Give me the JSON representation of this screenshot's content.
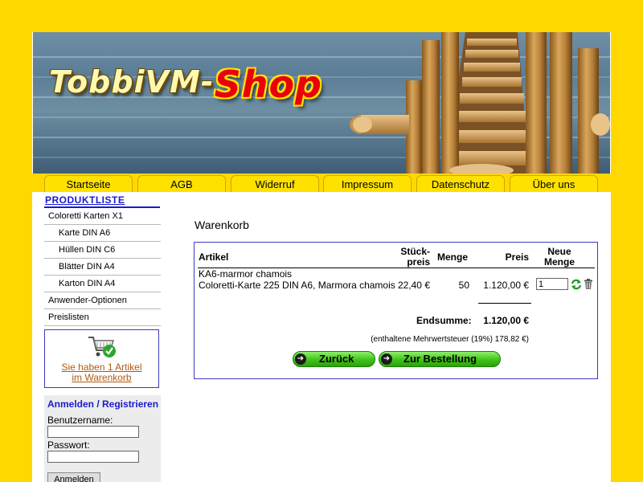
{
  "header": {
    "logo_part1": "TobbiVM-",
    "logo_part2": "Shop"
  },
  "nav": [
    "Startseite",
    "AGB",
    "Widerruf",
    "Impressum",
    "Datenschutz",
    "Über uns"
  ],
  "sidebar": {
    "heading": "PRODUKTLISTE",
    "items": [
      {
        "label": "Coloretti Karten X1",
        "sub": false
      },
      {
        "label": "Karte DIN A6",
        "sub": true
      },
      {
        "label": "Hüllen DIN C6",
        "sub": true
      },
      {
        "label": "Blätter DIN A4",
        "sub": true
      },
      {
        "label": "Karton DIN A4",
        "sub": true
      },
      {
        "label": "Anwender-Optionen",
        "sub": false
      },
      {
        "label": "Preislisten",
        "sub": false
      }
    ],
    "cart_line1": "Sie haben 1 Artikel",
    "cart_line2": "im Warenkorb"
  },
  "login": {
    "title": "Anmelden / Registrieren",
    "username_label": "Benutzername:",
    "password_label": "Passwort:",
    "button": "Anmelden"
  },
  "main": {
    "title": "Warenkorb",
    "headers": {
      "article": "Artikel",
      "unit_price_1": "Stück-",
      "unit_price_2": "preis",
      "quantity": "Menge",
      "price": "Preis",
      "new_qty_1": "Neue",
      "new_qty_2": "Menge"
    },
    "row": {
      "code": "KA6-marmor chamois",
      "description": "Coloretti-Karte 225 DIN A6, Marmora chamois",
      "unit_price": "22,40 €",
      "quantity": "50",
      "price": "1.120,00 €",
      "new_qty": "1"
    },
    "total_label": "Endsumme:",
    "total_value": "1.120,00 €",
    "vat_note": "(enthaltene Mehrwertsteuer (19%) 178,82 €)",
    "back_button": "Zurück",
    "order_button": "Zur Bestellung"
  }
}
